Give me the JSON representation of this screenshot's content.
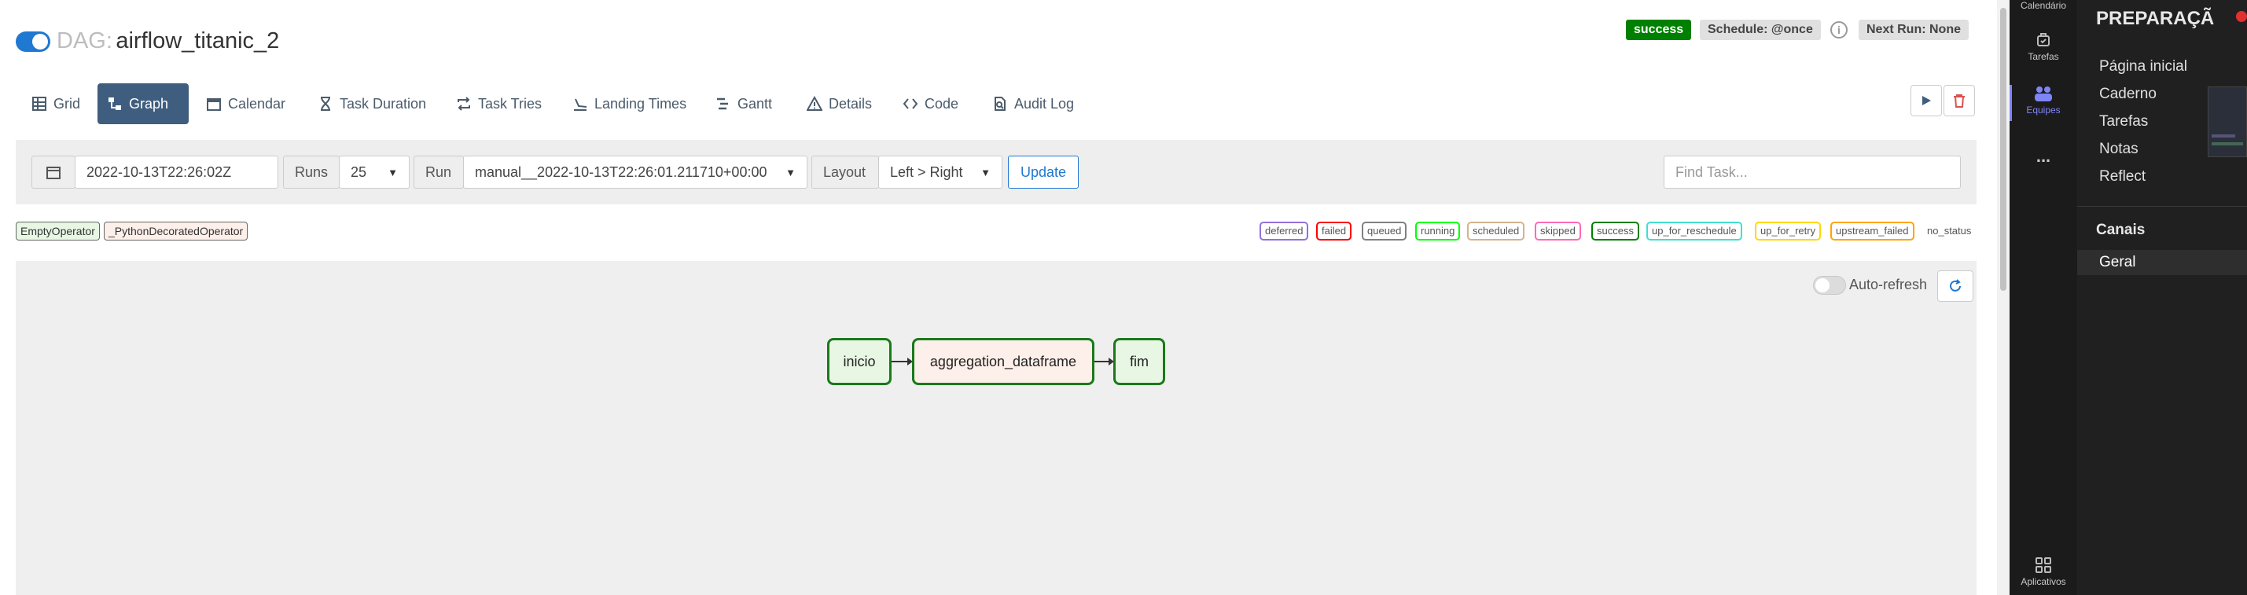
{
  "dag": {
    "prefix": "DAG:",
    "name": "airflow_titanic_2"
  },
  "header_badges": {
    "status": "success",
    "schedule": "Schedule: @once",
    "next_run": "Next Run: None"
  },
  "tabs": [
    {
      "label": "Grid",
      "icon": "grid-icon"
    },
    {
      "label": "Graph",
      "icon": "graph-icon",
      "active": true
    },
    {
      "label": "Calendar",
      "icon": "calendar-icon"
    },
    {
      "label": "Task Duration",
      "icon": "hourglass-icon"
    },
    {
      "label": "Task Tries",
      "icon": "retry-icon"
    },
    {
      "label": "Landing Times",
      "icon": "landing-icon"
    },
    {
      "label": "Gantt",
      "icon": "gantt-icon"
    },
    {
      "label": "Details",
      "icon": "warning-icon"
    },
    {
      "label": "Code",
      "icon": "code-icon"
    },
    {
      "label": "Audit Log",
      "icon": "audit-log-icon"
    }
  ],
  "controls": {
    "date": "2022-10-13T22:26:02Z",
    "runs_label": "Runs",
    "runs_value": "25",
    "run_label": "Run",
    "run_value": "manual__2022-10-13T22:26:01.211710+00:00",
    "layout_label": "Layout",
    "layout_value": "Left > Right",
    "update_label": "Update",
    "find_placeholder": "Find Task..."
  },
  "operators": [
    {
      "label": "EmptyOperator",
      "color": "#e8f7e4"
    },
    {
      "label": "_PythonDecoratedOperator",
      "color": "#fdefe9"
    }
  ],
  "states": [
    {
      "label": "deferred",
      "color": "#9370db"
    },
    {
      "label": "failed",
      "color": "#ff0000"
    },
    {
      "label": "queued",
      "color": "#808080"
    },
    {
      "label": "running",
      "color": "#00ff00"
    },
    {
      "label": "scheduled",
      "color": "#d2b48c"
    },
    {
      "label": "skipped",
      "color": "#ff69b4"
    },
    {
      "label": "success",
      "color": "#008000"
    },
    {
      "label": "up_for_reschedule",
      "color": "#40e0d0"
    },
    {
      "label": "up_for_retry",
      "color": "#ffd700"
    },
    {
      "label": "upstream_failed",
      "color": "#ffa500"
    },
    {
      "label": "no_status",
      "color": "none"
    }
  ],
  "graph": {
    "auto_refresh_label": "Auto-refresh",
    "nodes": [
      {
        "label": "inicio",
        "operator": "EmptyOperator"
      },
      {
        "label": "aggregation_dataframe",
        "operator": "_PythonDecoratedOperator"
      },
      {
        "label": "fim",
        "operator": "EmptyOperator"
      }
    ]
  },
  "teams": {
    "rail": [
      {
        "label": "Calendário",
        "icon": "calendar-icon"
      },
      {
        "label": "Tarefas",
        "icon": "tasks-icon"
      },
      {
        "label": "Equipes",
        "icon": "teams-icon",
        "active": true
      },
      {
        "label": "...",
        "icon": "more-icon"
      },
      {
        "label": "Aplicativos",
        "icon": "apps-icon"
      }
    ],
    "panel_title": "PREPARAÇÃ",
    "links": [
      "Página inicial",
      "Caderno",
      "Tarefas",
      "Notas",
      "Reflect"
    ],
    "channels_heading": "Canais",
    "channels": [
      "Geral"
    ]
  }
}
